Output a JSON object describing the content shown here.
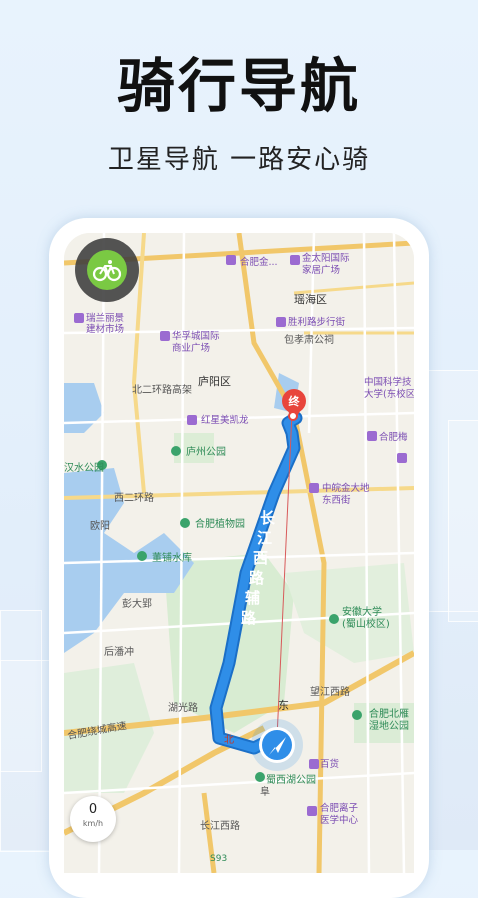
{
  "headline": "骑行导航",
  "tagline": "卫星导航 一路安心骑",
  "map": {
    "labels": {
      "hefei_jin": "合肥金...",
      "jintaiyang": "金太阳国际",
      "jintaiyang2": "家居广场",
      "yaohai": "瑶海区",
      "ruilan": "瑞兰丽景",
      "ruilan2": "建材市场",
      "huaxiang": "华孚城国际",
      "huaxiang2": "商业广场",
      "shenghua": "胜利路步行街",
      "baohe": "包孝肃公祠",
      "luyang": "庐阳区",
      "zhongke": "中国科学技",
      "zhongke2": "大学(东校区)",
      "hongxing": "红星美凯龙",
      "luzhou": "庐州公园",
      "hefeimu": "合肥梅",
      "beierhuan": "北二环路高架",
      "shuigong": "汉水公园",
      "xierhuan": "西二环路",
      "zhongwan": "中皖金大地",
      "dongxijie": "东西街",
      "ouyang": "欧阳",
      "zhiwuyuan": "合肥植物园",
      "dongpu": "董铺水库",
      "pengzhuang": "彭大郢",
      "anhui": "安徽大学",
      "anhui2": "(蜀山校区)",
      "houpan": "后潘冲",
      "huanxie": "合肥绕城高速",
      "huguanglu": "湖光路",
      "wangjiang": "望江西路",
      "dong": "东",
      "hefeibei": "合肥北雁",
      "shidi": "湿地公园",
      "baihuo": "百货",
      "shuxihu": "蜀西湖公园",
      "hefeilizi": "合肥离子",
      "yixue": "医学中心",
      "changjiang_route": "长江西路辅路",
      "changjiang_road": "长江西路",
      "exit": "S93",
      "end_marker": "终",
      "road_bei": "北",
      "fu": "阜"
    },
    "speed": {
      "value": "0",
      "unit": "km/h"
    }
  },
  "colors": {
    "route": "#2f8ee8",
    "route_border": "#1b6fc7",
    "end_marker": "#e8453c",
    "bike_green": "#7ac943"
  }
}
